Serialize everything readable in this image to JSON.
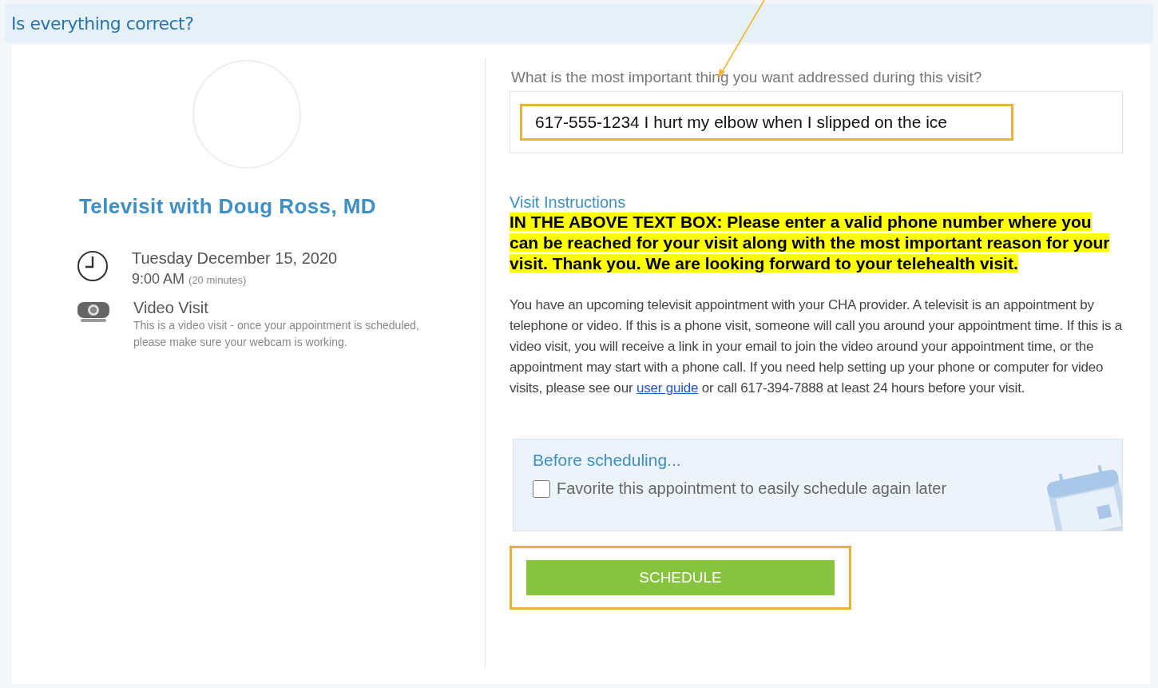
{
  "page_title": "Is everything correct?",
  "annotation_arrow": true,
  "provider": {
    "title": "Televisit with Doug Ross, MD"
  },
  "details": [
    {
      "kind": "time",
      "line1": "Tuesday December 15, 2020",
      "line2": "9:00 AM",
      "note": "(20 minutes)"
    },
    {
      "kind": "video",
      "line1": "Video Visit",
      "line2": "This is a video visit - once your appointment is scheduled, please make sure your webcam is working."
    }
  ],
  "question": {
    "label": "What is the most important thing you want addressed during this visit?",
    "value": "617-555-1234 I hurt my elbow when I slipped on the ice",
    "highlighted": true
  },
  "instructions": {
    "heading": "Visit Instructions",
    "highlight_text": "IN THE ABOVE TEXT BOX: Please enter a valid phone number where you can be reached for your visit along with the most important reason for your visit. Thank you. We are looking forward to your telehealth visit.",
    "body_before": "You have an upcoming televisit appointment with your CHA provider. A televisit is an appointment by telephone or video. If this is a phone visit, someone will call you around your appointment time. If this is a video visit, you will receive a link in your email to join the video around your appointment time, or the appointment may start with a phone call. If you need help setting up your phone or computer for video visits, please see our",
    "link": "user guide",
    "body_after": "or call 617-394-7888 at least 24 hours before your visit."
  },
  "before_scheduling": {
    "heading": "Before scheduling...",
    "favorite_label": "Favorite this appointment to easily schedule again later",
    "checked": false
  },
  "schedule_button": {
    "label": "SCHEDULE",
    "highlighted": true
  }
}
